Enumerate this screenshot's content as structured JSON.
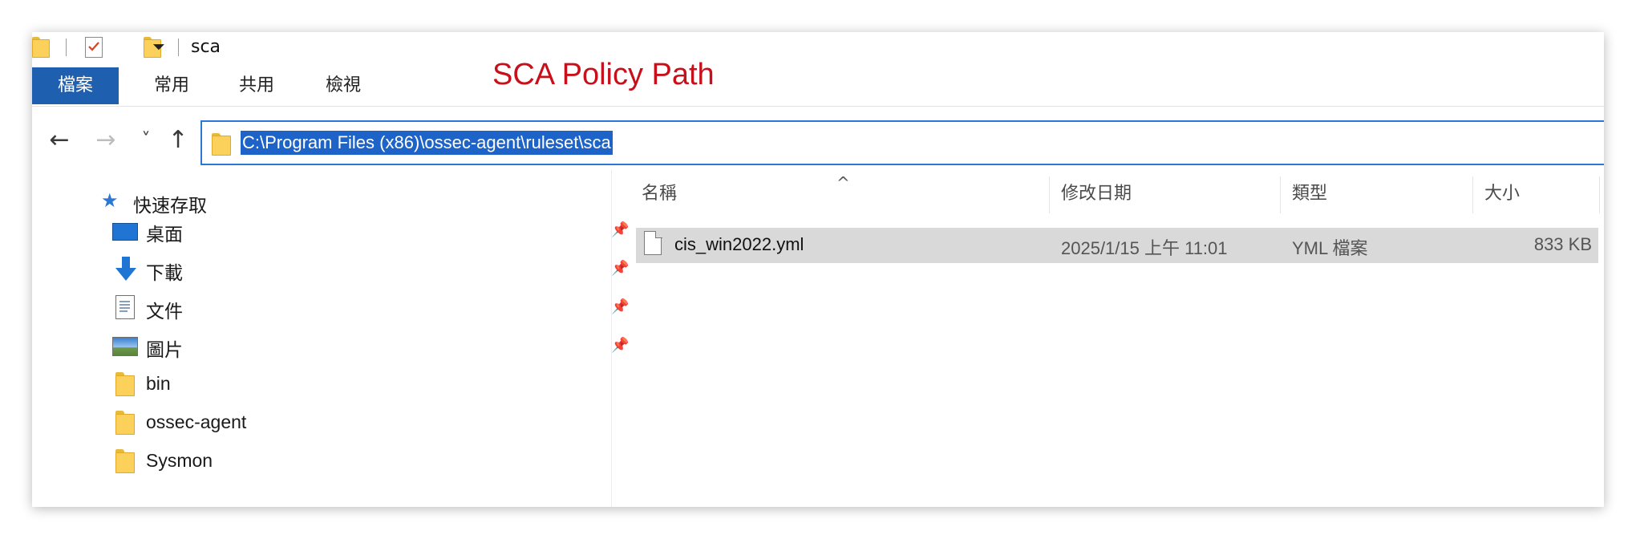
{
  "window": {
    "title": "sca"
  },
  "annotation": {
    "text": "SCA Policy Path"
  },
  "ribbon": {
    "tabs": [
      {
        "label": "檔案",
        "active": true
      },
      {
        "label": "常用"
      },
      {
        "label": "共用"
      },
      {
        "label": "檢視"
      }
    ]
  },
  "nav": {
    "back_icon": "←",
    "forward_icon": "→",
    "recent_icon": "˅",
    "up_icon": "↑",
    "address": "C:\\Program Files (x86)\\ossec-agent\\ruleset\\sca"
  },
  "sidebar": {
    "quick_access": "快速存取",
    "items": [
      {
        "label": "桌面",
        "icon": "desktop-icon",
        "pinned": true
      },
      {
        "label": "下載",
        "icon": "download-icon",
        "pinned": true
      },
      {
        "label": "文件",
        "icon": "documents-icon",
        "pinned": true
      },
      {
        "label": "圖片",
        "icon": "pictures-icon",
        "pinned": true
      },
      {
        "label": "bin",
        "icon": "folder-icon",
        "pinned": false
      },
      {
        "label": "ossec-agent",
        "icon": "folder-icon",
        "pinned": false
      },
      {
        "label": "Sysmon",
        "icon": "folder-icon",
        "pinned": false
      }
    ],
    "pin_glyph": "📌"
  },
  "file_list": {
    "sort_indicator": "^",
    "columns": [
      "名稱",
      "修改日期",
      "類型",
      "大小"
    ],
    "rows": [
      {
        "name": "cis_win2022.yml",
        "modified": "2025/1/15 上午 11:01",
        "type": "YML 檔案",
        "size": "833 KB",
        "selected": true
      }
    ]
  },
  "colors": {
    "file_tab": "#1e5fb0",
    "address_border": "#2a78d4",
    "selection": "#1e64c8",
    "annotation": "#c8101a",
    "row_highlight": "#d9d9d9"
  }
}
